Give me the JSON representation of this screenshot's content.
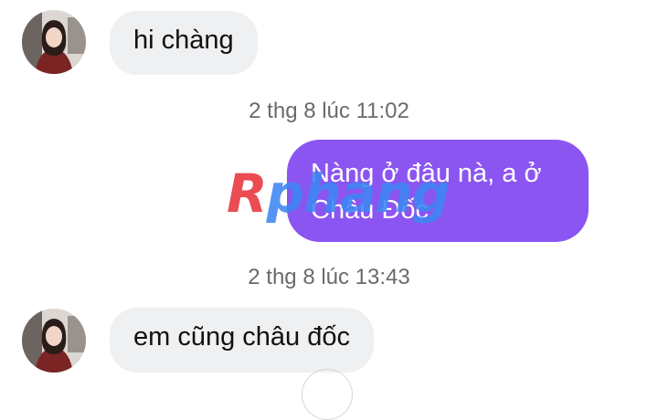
{
  "messages": [
    {
      "kind": "incoming",
      "text": "hi chàng"
    },
    {
      "kind": "timestamp",
      "text": "2 thg 8 lúc 11:02"
    },
    {
      "kind": "outgoing",
      "text": "Nàng ở đâu nà, a ở Châu Đốc"
    },
    {
      "kind": "timestamp",
      "text": "2 thg 8 lúc 13:43"
    },
    {
      "kind": "incoming",
      "text": "em cũng châu đốc"
    }
  ],
  "watermark": {
    "part1": "R",
    "part2": "phang"
  },
  "colors": {
    "outgoing_bubble": "#8b55f2",
    "incoming_bubble": "#eff0f2",
    "timestamp_text": "#6a6a6a"
  }
}
